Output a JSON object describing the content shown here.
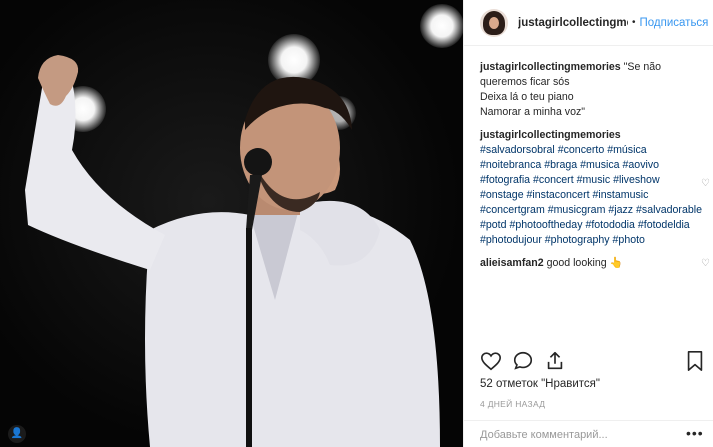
{
  "post": {
    "photo_alt": "performer singing",
    "more_label": "•••"
  },
  "header": {
    "username": "justagirlcollectingmemories",
    "separator": "•",
    "follow_label": "Подписаться"
  },
  "comments": [
    {
      "user": "justagirlcollectingmemories",
      "text": "\"Se não queremos ficar sós\nDeixa lá o teu piano\nNamorar a minha voz\"",
      "has_like": false
    },
    {
      "user": "justagirlcollectingmemories",
      "text": "",
      "tags": "#salvadorsobral #concerto #música #noitebranca #braga #musica #aovivo #fotografia #concert #music #liveshow #onstage #instaconcert #instamusic #concertgram #musicgram #jazz #salvadorable #potd #photooftheday #fotododia #fotodeldia #photodujour #photography #photo",
      "has_like": true
    },
    {
      "user": "alieisamfan2",
      "text": "good looking",
      "emoji": "👆",
      "has_like": true
    }
  ],
  "likes_text": "52 отметок \"Нравится\"",
  "time_ago": "4 ДНЕЙ НАЗАД",
  "add_comment_placeholder": "Добавьте комментарий...",
  "icons": {
    "like": "heart-icon",
    "comment": "comment-icon",
    "share": "share-icon",
    "save": "bookmark-icon",
    "comment_like": "small-heart-icon",
    "tag_people": "person-icon"
  }
}
